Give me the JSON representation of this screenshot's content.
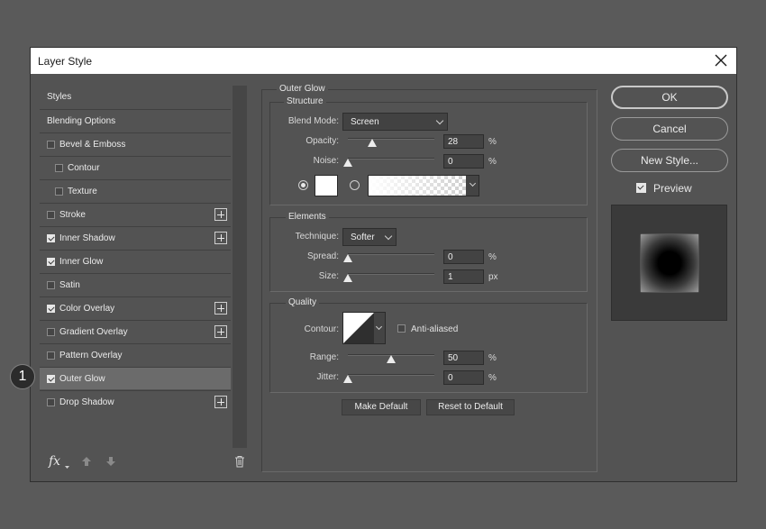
{
  "dialog": {
    "title": "Layer Style"
  },
  "styles_list": {
    "items": [
      {
        "label": "Styles",
        "checkbox": false,
        "indent": false,
        "plus": false,
        "checked": false,
        "selected": false
      },
      {
        "label": "Blending Options",
        "checkbox": false,
        "indent": false,
        "plus": false,
        "checked": false,
        "selected": false
      },
      {
        "label": "Bevel & Emboss",
        "checkbox": true,
        "indent": false,
        "plus": false,
        "checked": false,
        "selected": false
      },
      {
        "label": "Contour",
        "checkbox": true,
        "indent": true,
        "plus": false,
        "checked": false,
        "selected": false
      },
      {
        "label": "Texture",
        "checkbox": true,
        "indent": true,
        "plus": false,
        "checked": false,
        "selected": false
      },
      {
        "label": "Stroke",
        "checkbox": true,
        "indent": false,
        "plus": true,
        "checked": false,
        "selected": false
      },
      {
        "label": "Inner Shadow",
        "checkbox": true,
        "indent": false,
        "plus": true,
        "checked": true,
        "selected": false
      },
      {
        "label": "Inner Glow",
        "checkbox": true,
        "indent": false,
        "plus": false,
        "checked": true,
        "selected": false
      },
      {
        "label": "Satin",
        "checkbox": true,
        "indent": false,
        "plus": false,
        "checked": false,
        "selected": false
      },
      {
        "label": "Color Overlay",
        "checkbox": true,
        "indent": false,
        "plus": true,
        "checked": true,
        "selected": false
      },
      {
        "label": "Gradient Overlay",
        "checkbox": true,
        "indent": false,
        "plus": true,
        "checked": false,
        "selected": false
      },
      {
        "label": "Pattern Overlay",
        "checkbox": true,
        "indent": false,
        "plus": false,
        "checked": false,
        "selected": false
      },
      {
        "label": "Outer Glow",
        "checkbox": true,
        "indent": false,
        "plus": false,
        "checked": true,
        "selected": true
      },
      {
        "label": "Drop Shadow",
        "checkbox": true,
        "indent": false,
        "plus": true,
        "checked": false,
        "selected": false
      }
    ],
    "footer": {
      "fx_label": "fx"
    }
  },
  "step_marker": "1",
  "outer_glow": {
    "title": "Outer Glow",
    "structure": {
      "title": "Structure",
      "blend_mode_label": "Blend Mode:",
      "blend_mode_value": "Screen",
      "opacity_label": "Opacity:",
      "opacity_value": "28",
      "opacity_unit": "%",
      "opacity_level": 0.28,
      "noise_label": "Noise:",
      "noise_value": "0",
      "noise_unit": "%",
      "noise_level": 0.0,
      "swatch_color": "#ffffff",
      "color_radio_selected": true
    },
    "elements": {
      "title": "Elements",
      "technique_label": "Technique:",
      "technique_value": "Softer",
      "spread_label": "Spread:",
      "spread_value": "0",
      "spread_unit": "%",
      "spread_level": 0.0,
      "size_label": "Size:",
      "size_value": "1",
      "size_unit": "px",
      "size_level": 0.004
    },
    "quality": {
      "title": "Quality",
      "contour_label": "Contour:",
      "anti_aliased_label": "Anti-aliased",
      "anti_aliased_checked": false,
      "range_label": "Range:",
      "range_value": "50",
      "range_unit": "%",
      "range_level": 0.5,
      "jitter_label": "Jitter:",
      "jitter_value": "0",
      "jitter_unit": "%",
      "jitter_level": 0.0
    },
    "make_default_label": "Make Default",
    "reset_default_label": "Reset to Default"
  },
  "actions": {
    "ok_label": "OK",
    "cancel_label": "Cancel",
    "new_style_label": "New Style...",
    "preview_label": "Preview",
    "preview_checked": true
  },
  "icons": {
    "close": "close-icon",
    "fx": "fx-icon",
    "up": "arrow-up-icon",
    "down": "arrow-down-icon",
    "trash": "trash-icon"
  }
}
